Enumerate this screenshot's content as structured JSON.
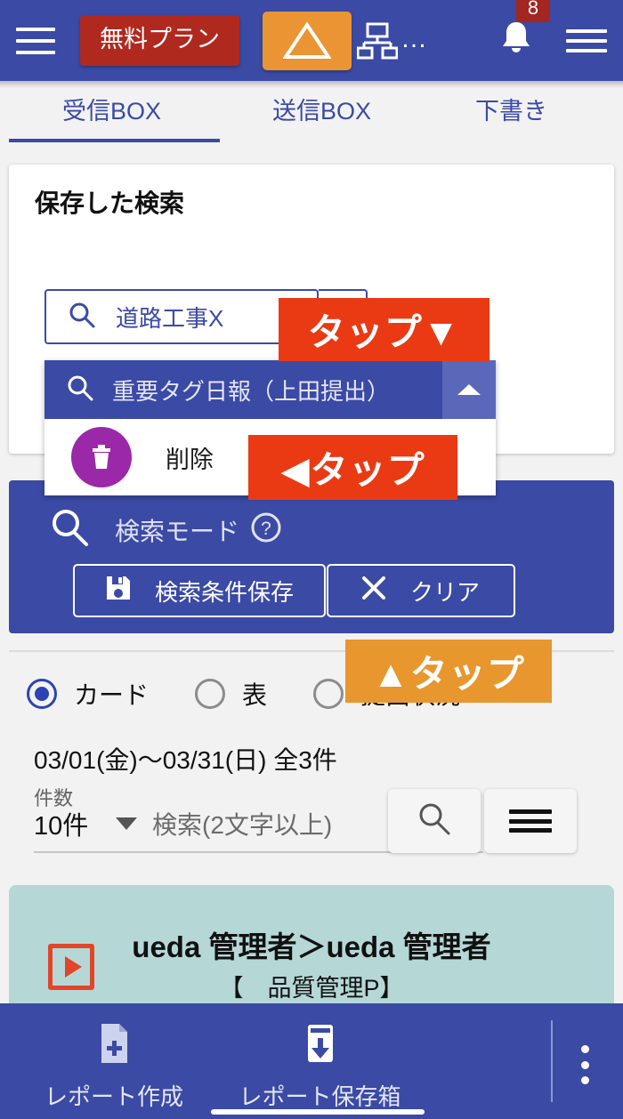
{
  "header": {
    "menu_icon": "hamburger-menu-icon",
    "free_plan_label": "無料プラン",
    "logo_icon": "triangle-logo-icon",
    "org_chart_icon": "org-chart-icon",
    "org_chart_overflow": "…",
    "bell_icon": "notification-bell-icon",
    "notification_count": "8",
    "right_menu_icon": "hamburger-menu-icon",
    "bg_color": "#3b4aa5",
    "free_plan_color": "#b0291f",
    "logo_color": "#eb9434"
  },
  "tabs": {
    "items": [
      {
        "label": "受信BOX",
        "active": true
      },
      {
        "label": "送信BOX",
        "active": false
      },
      {
        "label": "下書き",
        "active": false
      }
    ],
    "active_color": "#3b4aa5",
    "draft_color": "#e58a2e"
  },
  "saved_search": {
    "title": "保存した検索",
    "search_icon": "search-icon",
    "input_value": "道路工事X",
    "toggle_icon": "chevron-strip",
    "dropdown": {
      "selected": {
        "search_icon": "search-icon",
        "label": "重要タグ日報（上田提出）",
        "collapse_icon": "chevron-up-icon"
      },
      "delete_item": {
        "icon": "trash-icon",
        "label": "削除",
        "icon_bg": "#9a28a8"
      }
    }
  },
  "overlays": [
    {
      "id": "tap-overlay-dropdown",
      "text": "タップ▼",
      "color": "#ea3a13"
    },
    {
      "id": "tap-overlay-delete",
      "text": "◀タップ",
      "color": "#ea3a13"
    },
    {
      "id": "tap-overlay-card",
      "text": "▲タップ",
      "color": "#e8962e"
    }
  ],
  "search_mode": {
    "search_icon": "search-icon",
    "label": "検索モード",
    "help_icon": "help-circle-icon",
    "save_button": {
      "icon": "save-disk-icon",
      "label": "検索条件保存"
    },
    "clear_button": {
      "icon": "close-x-icon",
      "label": "クリア"
    },
    "bg_color": "#3b4aa5"
  },
  "view_modes": {
    "options": [
      {
        "label": "カード",
        "selected": true
      },
      {
        "label": "表",
        "selected": false
      },
      {
        "label": "提出状況",
        "selected": false
      }
    ],
    "selected_color": "#2c43b5"
  },
  "result_summary": {
    "date_range": "03/01(金)〜03/31(日) 全3件",
    "count_label": "件数",
    "count_value": "10件",
    "filter_caret_icon": "caret-down-icon",
    "filter_placeholder": "検索(2文字以上)",
    "search_button_icon": "search-icon",
    "list_menu_icon": "hamburger-menu-icon"
  },
  "result_card": {
    "play_icon": "play-box-icon",
    "title": "ueda 管理者＞ueda 管理者",
    "subtitle": "【　品質管理P】",
    "bg_color": "#b5d8d7"
  },
  "bottom_nav": {
    "items": [
      {
        "icon": "file-plus-icon",
        "label": "レポート作成"
      },
      {
        "icon": "inbox-download-icon",
        "label": "レポート保存箱"
      }
    ],
    "overflow_icon": "more-vertical-icon",
    "bg_color": "#3b4aa5"
  }
}
